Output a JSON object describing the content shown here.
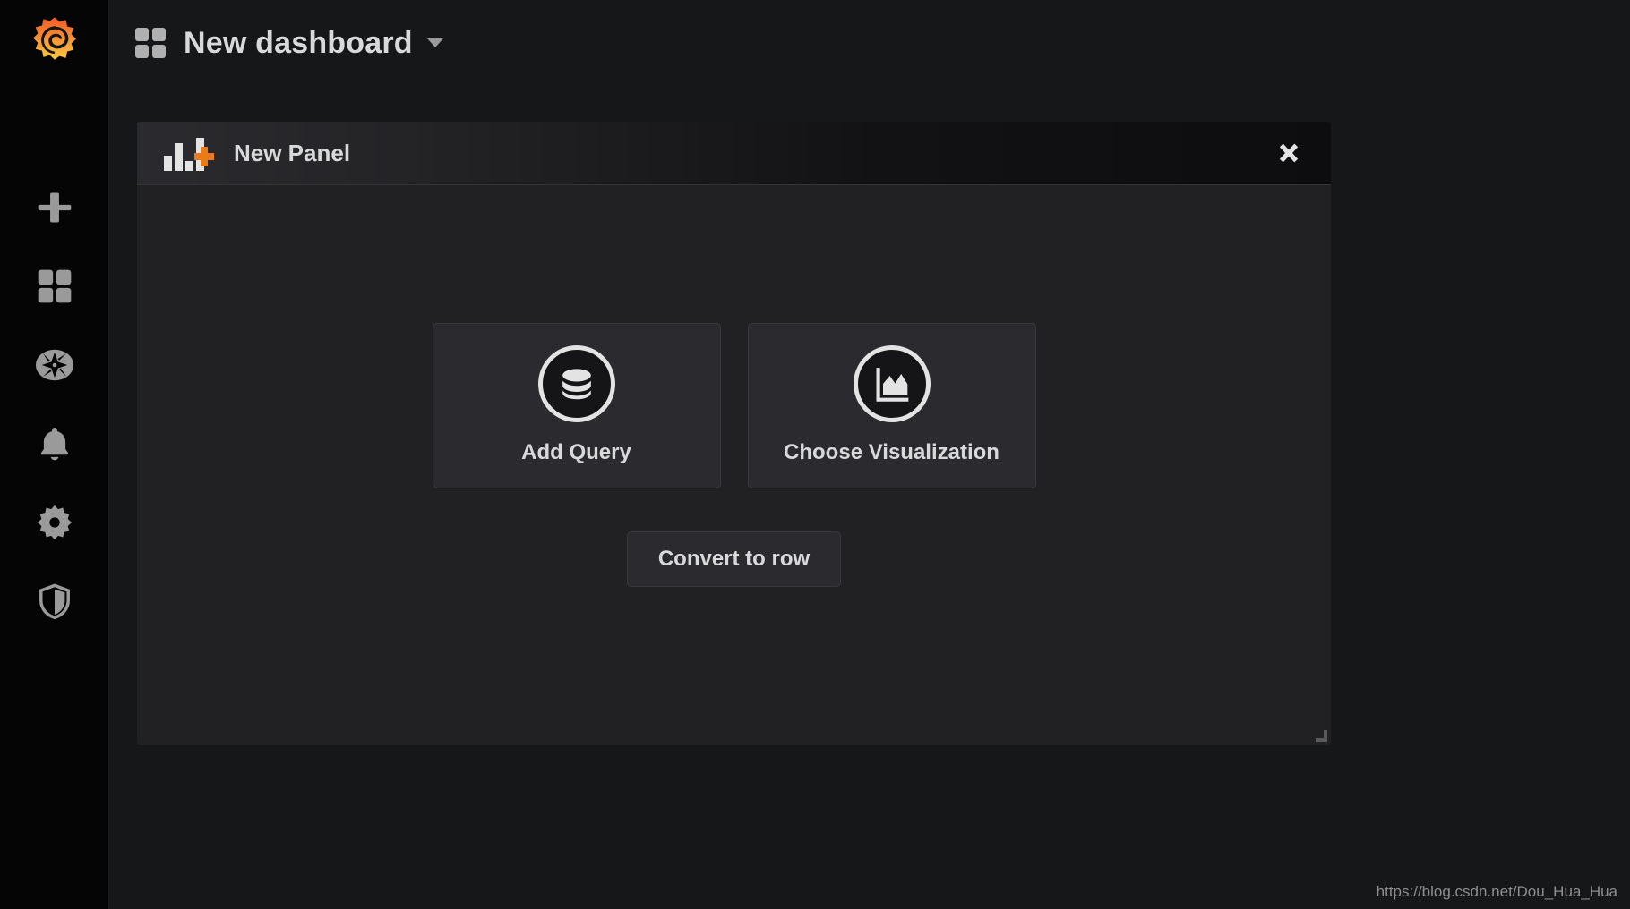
{
  "sidebar": {
    "logo_name": "grafana-logo",
    "logo_colors": {
      "top": "#f05a28",
      "bottom": "#fbca3e"
    },
    "items": [
      {
        "name": "create",
        "icon": "plus-icon"
      },
      {
        "name": "dashboards",
        "icon": "dashboards-grid-icon"
      },
      {
        "name": "explore",
        "icon": "compass-icon"
      },
      {
        "name": "alerting",
        "icon": "bell-icon"
      },
      {
        "name": "configuration",
        "icon": "gear-icon"
      },
      {
        "name": "server-admin",
        "icon": "shield-icon"
      }
    ]
  },
  "header": {
    "dashboard_icon": "dashboard-grid-icon",
    "title": "New dashboard",
    "caret_icon": "chevron-down-icon"
  },
  "panel": {
    "type_icon": "bar-chart-plus-icon",
    "title": "New Panel",
    "close_icon": "close-icon",
    "accent_color": "#eb7b18",
    "cards": [
      {
        "label": "Add Query",
        "icon": "database-icon"
      },
      {
        "label": "Choose Visualization",
        "icon": "area-chart-icon"
      }
    ],
    "convert_to_row_label": "Convert to row",
    "resize_handle": "resize-handle-icon"
  },
  "watermark": {
    "text": "https://blog.csdn.net/Dou_Hua_Hua"
  }
}
